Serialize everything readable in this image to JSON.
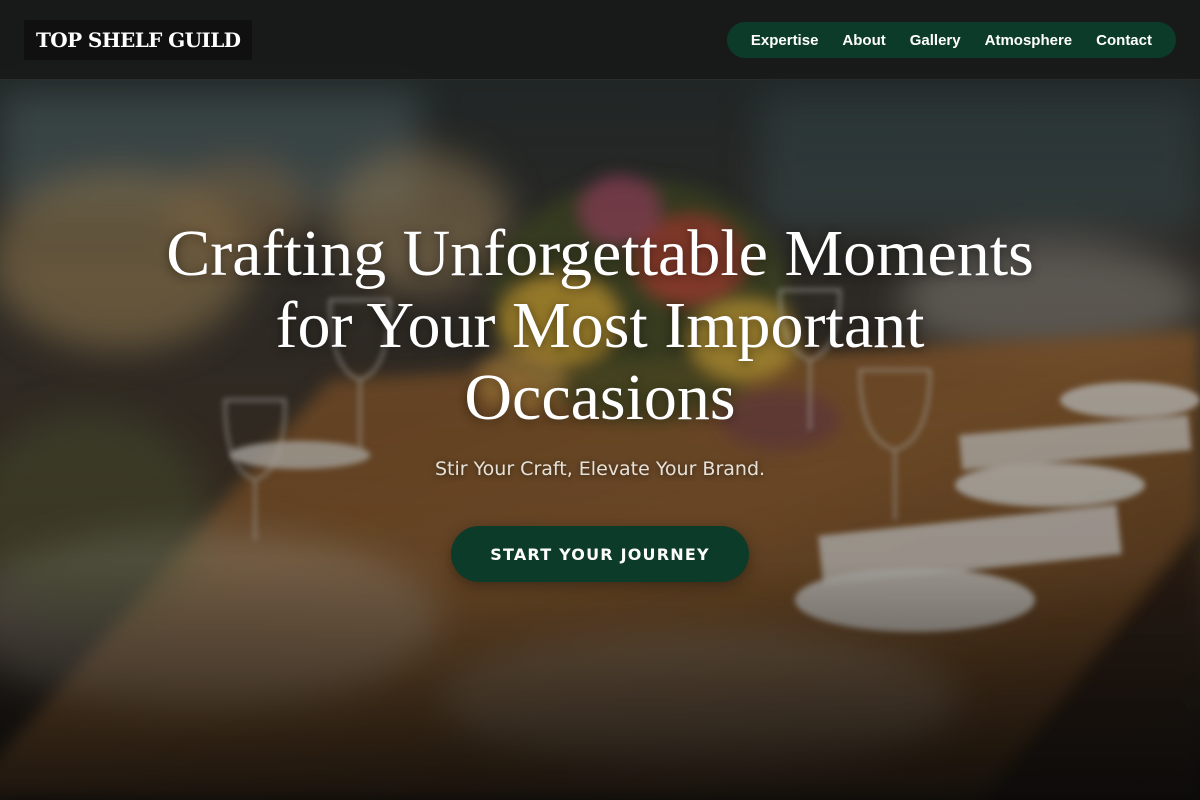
{
  "brand": {
    "name": "TOP SHELF GUILD"
  },
  "nav": {
    "items": [
      {
        "label": "Expertise"
      },
      {
        "label": "About"
      },
      {
        "label": "Gallery"
      },
      {
        "label": "Atmosphere"
      },
      {
        "label": "Contact"
      }
    ]
  },
  "hero": {
    "title": "Crafting Unforgettable Moments for Your Most Important Occasions",
    "subtitle": "Stir Your Craft, Elevate Your Brand.",
    "cta_label": "START YOUR JOURNEY",
    "background_image": "banquet-table-with-flowers-and-glasses"
  },
  "colors": {
    "accent": "#0d3b2a",
    "header_bg": "#181a19",
    "logo_bg": "#0f100f",
    "text": "#ffffff"
  }
}
